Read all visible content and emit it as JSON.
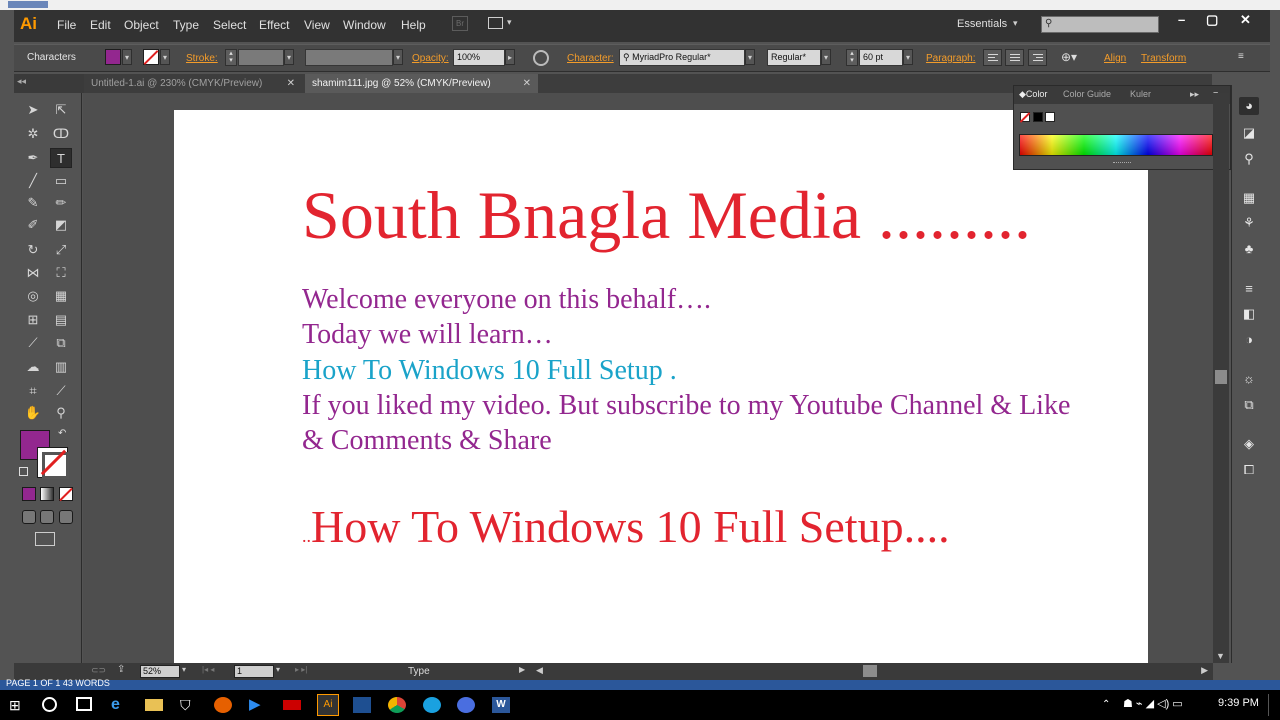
{
  "app": {
    "logo": "Ai"
  },
  "menu": [
    "File",
    "Edit",
    "Object",
    "Type",
    "Select",
    "Effect",
    "View",
    "Window",
    "Help"
  ],
  "bridge": "Br",
  "workspace": "Essentials",
  "control": {
    "label": "Characters",
    "stroke_label": "Stroke:",
    "opacity_label": "Opacity:",
    "opacity_value": "100%",
    "character_label": "Character:",
    "font_value": "MyriadPro Regular*",
    "style_value": "Regular*",
    "size_value": "60 pt",
    "paragraph_label": "Paragraph:",
    "align_label": "Align",
    "transform_label": "Transform",
    "fill_color": "#93278f"
  },
  "tabs": [
    {
      "label": "Untitled-1.ai @ 230% (CMYK/Preview)"
    },
    {
      "label": "shamim111.jpg @ 52% (CMYK/Preview)"
    }
  ],
  "color_panel": {
    "tabs": [
      "Color",
      "Color Guide",
      "Kuler"
    ]
  },
  "artboard": {
    "title": "South Bnagla Media .........",
    "lines": [
      "Welcome everyone on this behalf….",
      "Today we will learn…",
      "How To Windows 10 Full Setup .",
      "If you liked my video. But subscribe to my Youtube Channel & Like",
      "& Comments & Share"
    ],
    "footer_dots": "..",
    "footer": "How To Windows 10 Full Setup....",
    "colors": {
      "red": "#e2242f",
      "purple": "#93278f",
      "cyan": "#1aa3c9"
    }
  },
  "status": {
    "zoom": "52%",
    "page": "1",
    "tool": "Type"
  },
  "word_status": "PAGE 1 OF 1    43 WORDS",
  "taskbar": {
    "time": "9:39 PM"
  }
}
